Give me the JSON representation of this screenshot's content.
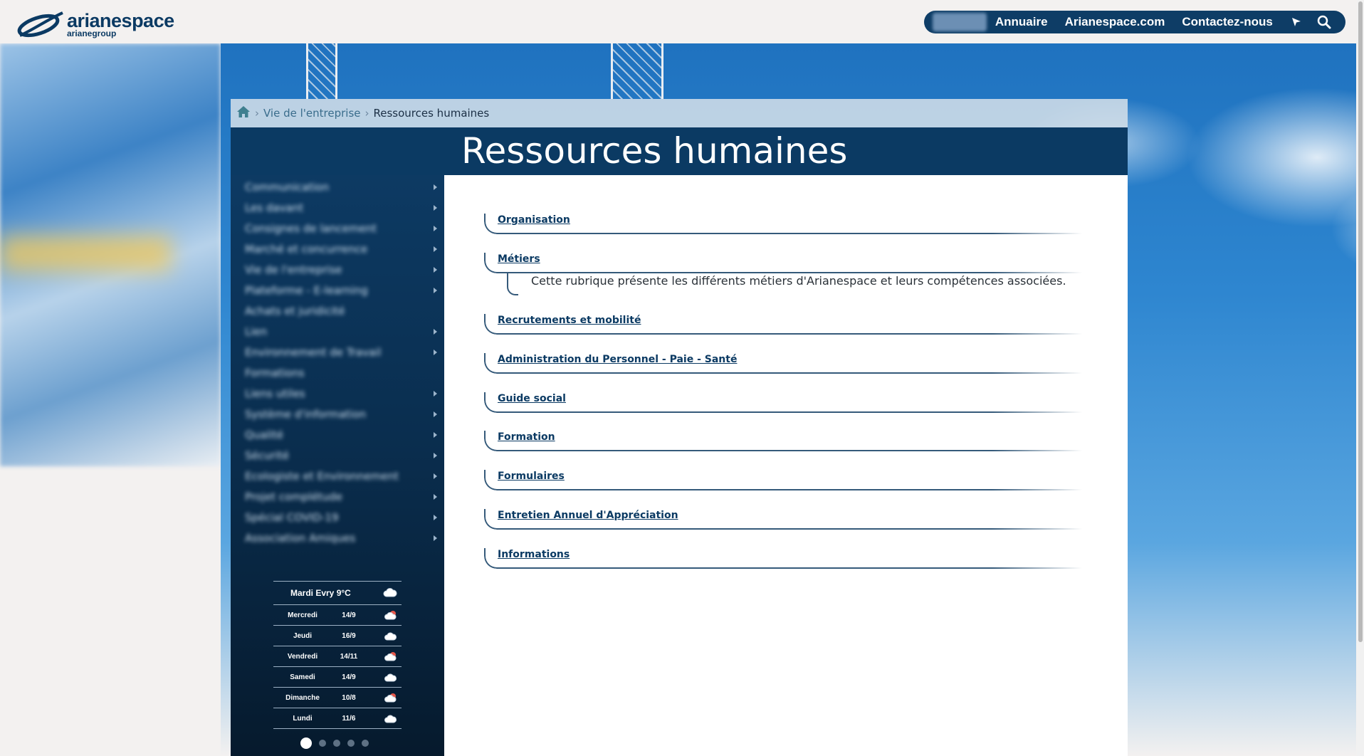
{
  "header": {
    "logo": {
      "brand": "arianespace",
      "sub": "arianegroup"
    },
    "nav": [
      {
        "label": "Annuaire"
      },
      {
        "label": "Arianespace.com"
      },
      {
        "label": "Contactez-nous"
      }
    ],
    "icons": [
      "cursor-icon",
      "search-icon"
    ]
  },
  "breadcrumb": {
    "items": [
      "Vie de l'entreprise",
      "Ressources humaines"
    ]
  },
  "page": {
    "title": "Ressources humaines"
  },
  "sidebar": {
    "menu": [
      {
        "label": "Communication",
        "arrow": true
      },
      {
        "label": "Les davant",
        "arrow": true
      },
      {
        "label": "Consignes de lancement",
        "arrow": true
      },
      {
        "label": "Marché et concurrence",
        "arrow": true
      },
      {
        "label": "Vie de l'entreprise",
        "arrow": true
      },
      {
        "label": "Plateforme - E-learning",
        "arrow": true
      },
      {
        "label": "Achats et juridicité",
        "arrow": false
      },
      {
        "label": "Lien",
        "arrow": true
      },
      {
        "label": "Environnement de Travail",
        "arrow": true
      },
      {
        "label": "Formations",
        "arrow": false
      },
      {
        "label": "Liens utiles",
        "arrow": true
      },
      {
        "label": "Système d'information",
        "arrow": true
      },
      {
        "label": "Qualité",
        "arrow": true
      },
      {
        "label": "Sécurité",
        "arrow": true
      },
      {
        "label": "Ecologiste et Environnement",
        "arrow": true
      },
      {
        "label": "Projet complétude",
        "arrow": true
      },
      {
        "label": "Spécial COVID-19",
        "arrow": true
      },
      {
        "label": "Association Amiques",
        "arrow": true
      }
    ],
    "weather": {
      "today": "Mardi Evry 9°C",
      "days": [
        {
          "day": "Mercredi",
          "temp": "14/9",
          "icon": "sun-cloud-icon"
        },
        {
          "day": "Jeudi",
          "temp": "16/9",
          "icon": "cloud-icon"
        },
        {
          "day": "Vendredi",
          "temp": "14/11",
          "icon": "sun-cloud-icon"
        },
        {
          "day": "Samedi",
          "temp": "14/9",
          "icon": "cloud-icon"
        },
        {
          "day": "Dimanche",
          "temp": "10/8",
          "icon": "sun-cloud-icon"
        },
        {
          "day": "Lundi",
          "temp": "11/6",
          "icon": "cloud-icon"
        }
      ],
      "pager": {
        "count": 5,
        "active": 1
      }
    }
  },
  "content": {
    "sections": [
      {
        "title": "Organisation"
      },
      {
        "title": "Métiers",
        "description": "Cette rubrique présente les différents métiers d'Arianespace et leurs compétences associées."
      },
      {
        "title": "Recrutements et mobilité"
      },
      {
        "title": "Administration du Personnel - Paie - Santé"
      },
      {
        "title": "Guide social"
      },
      {
        "title": "Formation"
      },
      {
        "title": "Formulaires"
      },
      {
        "title": "Entretien Annuel d'Appréciation"
      },
      {
        "title": "Informations"
      }
    ]
  },
  "colors": {
    "navy": "#0b3a63",
    "sidebar_top": "#0d3a63",
    "sidebar_bottom": "#061a2d",
    "page_bg": "#f3f1f0",
    "breadcrumb_bg": "#d2dee8"
  }
}
